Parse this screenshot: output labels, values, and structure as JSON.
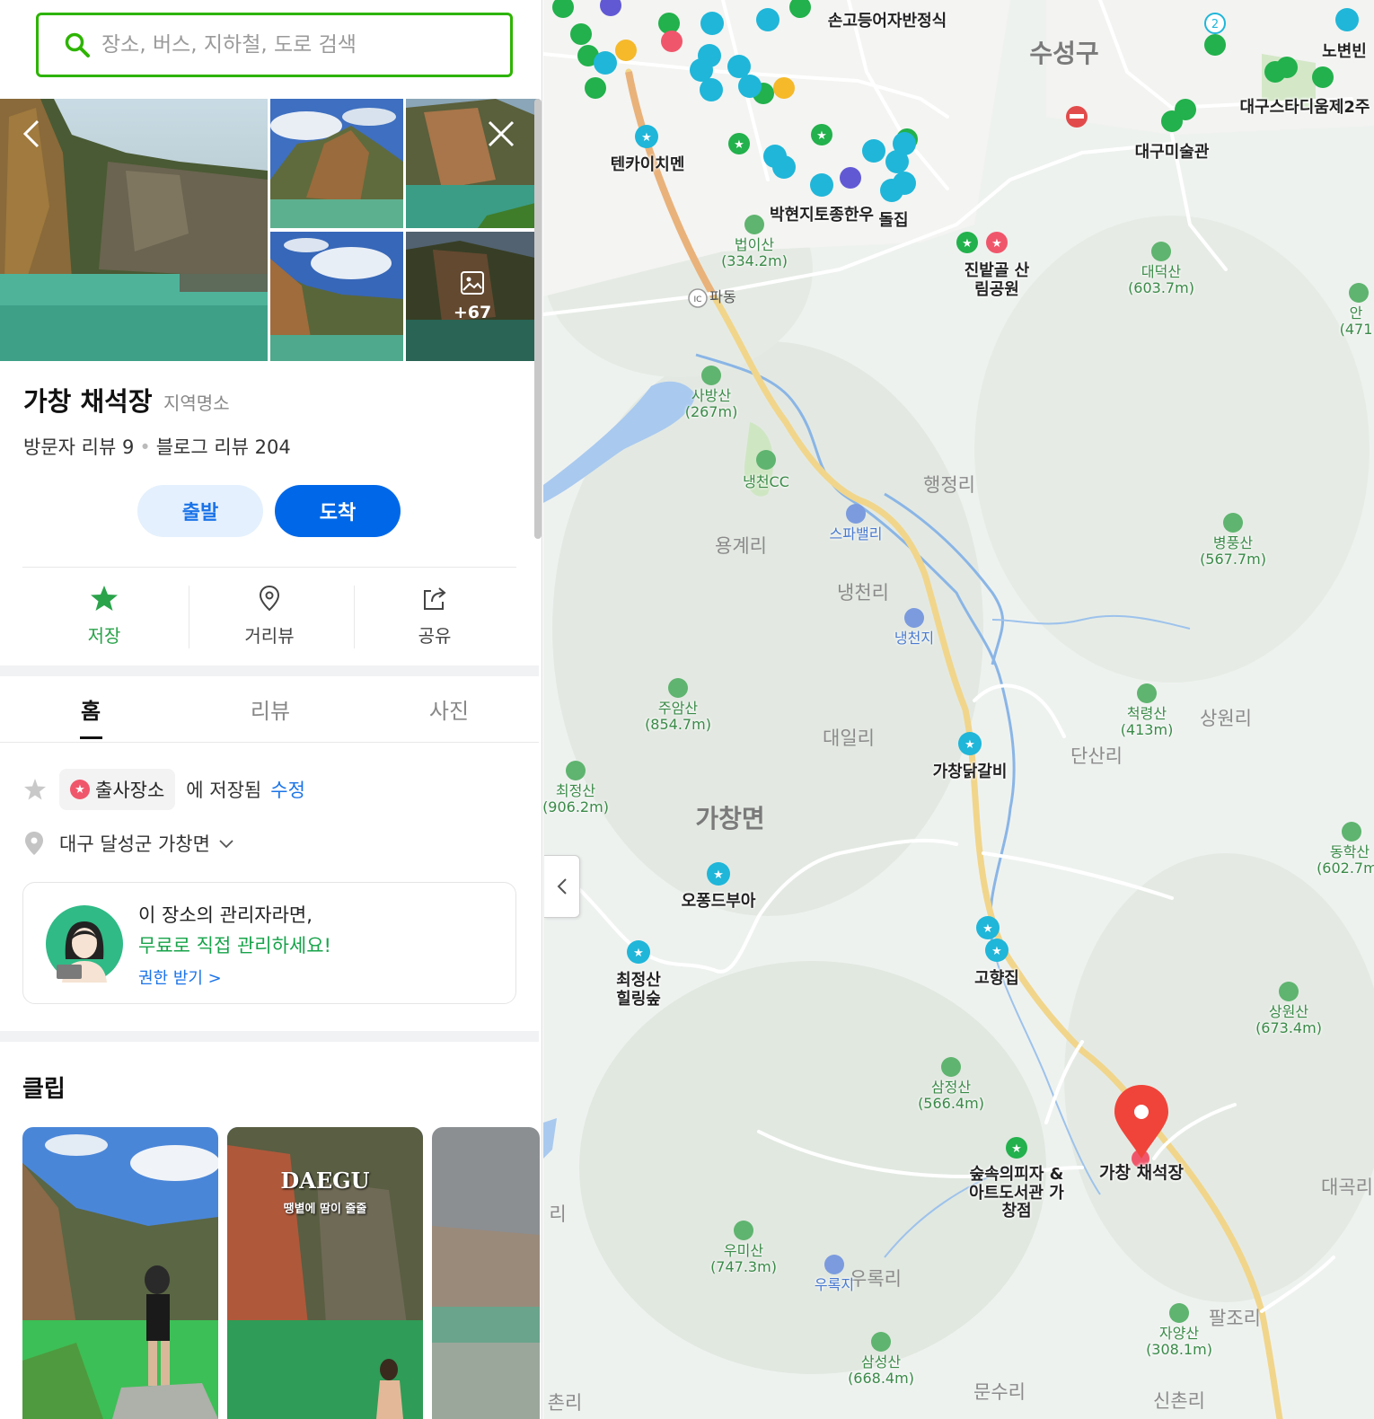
{
  "search": {
    "placeholder": "장소, 버스, 지하철, 도로 검색"
  },
  "photos": {
    "more_count": "+67"
  },
  "place": {
    "name": "가창 채석장",
    "category": "지역명소",
    "visitor_reviews": "방문자 리뷰 9",
    "blog_reviews": "블로그 리뷰 204",
    "depart_label": "출발",
    "arrive_label": "도착"
  },
  "actions": {
    "save": "저장",
    "street_view": "거리뷰",
    "share": "공유"
  },
  "tabs": {
    "home": "홈",
    "review": "리뷰",
    "photo": "사진"
  },
  "saved": {
    "list_name": "출사장소",
    "suffix": "에 저장됨",
    "edit": "수정"
  },
  "address": {
    "text": "대구 달성군 가창면"
  },
  "owner_card": {
    "line1": "이 장소의 관리자라면,",
    "line2": "무료로 직접 관리하세요!",
    "link": "권한 받기 >"
  },
  "clip": {
    "title": "클립",
    "clip2_caption": "DAEGU",
    "clip2_sub": "땡볕에 땀이 줄줄"
  },
  "map": {
    "areas": [
      "수성구",
      "행정리",
      "용계리",
      "냉천리",
      "대일리",
      "단산리",
      "상원리",
      "가창면",
      "대곡리",
      "팔조리",
      "문수리",
      "신촌리",
      "우록리",
      "리",
      "촌리"
    ],
    "pois": [
      "손고등어자반정식",
      "대구스타디움제2주",
      "노변빈",
      "대구미술관",
      "텐카이치멘",
      "박현지토종한우",
      "돌집",
      "진밭골 산림공원",
      "파동",
      "스파밸리",
      "냉천지",
      "가창닭갈비",
      "오퐁드부아",
      "최정산 힐링숲",
      "고향집",
      "숲속의피자 &아트도서관 가창점",
      "우록지",
      "냉천CC"
    ],
    "mountains": [
      {
        "name": "법이산",
        "height": "(334.2m)"
      },
      {
        "name": "대덕산",
        "height": "(603.7m)"
      },
      {
        "name": "사방산",
        "height": "(267m)"
      },
      {
        "name": "병풍산",
        "height": "(567.7m)"
      },
      {
        "name": "주암산",
        "height": "(854.7m)"
      },
      {
        "name": "척령산",
        "height": "(413m)"
      },
      {
        "name": "최정산",
        "height": "(906.2m)"
      },
      {
        "name": "동학산",
        "height": "(602.7m)"
      },
      {
        "name": "상원산",
        "height": "(673.4m)"
      },
      {
        "name": "삼정산",
        "height": "(566.4m)"
      },
      {
        "name": "우미산",
        "height": "(747.3m)"
      },
      {
        "name": "삼성산",
        "height": "(668.4m)"
      },
      {
        "name": "자양산",
        "height": "(308.1m)"
      },
      {
        "name": "안",
        "height": "(471"
      }
    ],
    "destination": "가창 채석장",
    "badge": "2",
    "ic_label": "IC"
  },
  "colors": {
    "brand_green": "#2db400",
    "blue_button": "#0068e8",
    "pin_red": "#f0443a",
    "poi_teal": "#1fb6d9",
    "poi_green": "#22b14c"
  }
}
